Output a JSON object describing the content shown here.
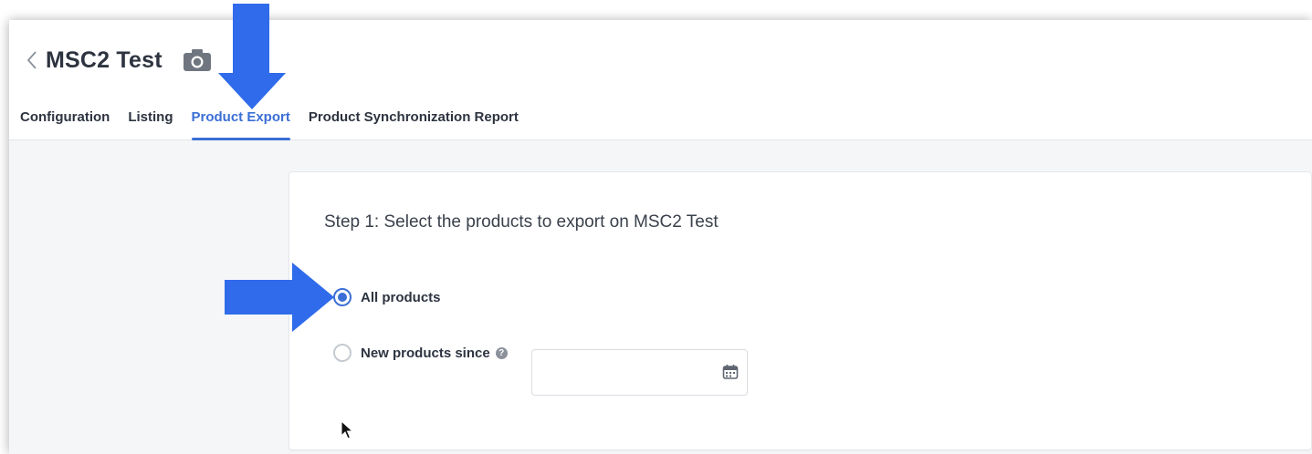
{
  "header": {
    "back_icon": "chevron-left-icon",
    "title": "MSC2 Test",
    "camera_icon": "camera-icon"
  },
  "tabs": [
    {
      "label": "Configuration",
      "active": false
    },
    {
      "label": "Listing",
      "active": false
    },
    {
      "label": "Product Export",
      "active": true
    },
    {
      "label": "Product Synchronization Report",
      "active": false
    }
  ],
  "step1": {
    "title": "Step 1: Select the products to export on MSC2 Test",
    "options": {
      "all_products": {
        "label": "All products",
        "selected": true
      },
      "new_products_since": {
        "label": "New products since",
        "selected": false,
        "help_icon": "help-circle-icon"
      }
    },
    "date_input": {
      "value": "",
      "placeholder": ""
    },
    "calendar_icon": "calendar-icon"
  },
  "colors": {
    "accent": "#3b6fd6",
    "annotation_arrow": "#2f6bea",
    "text": "#2d3440"
  },
  "annotations": {
    "arrow_down_icon": "arrow-down-icon",
    "arrow_right_icon": "arrow-right-icon"
  }
}
